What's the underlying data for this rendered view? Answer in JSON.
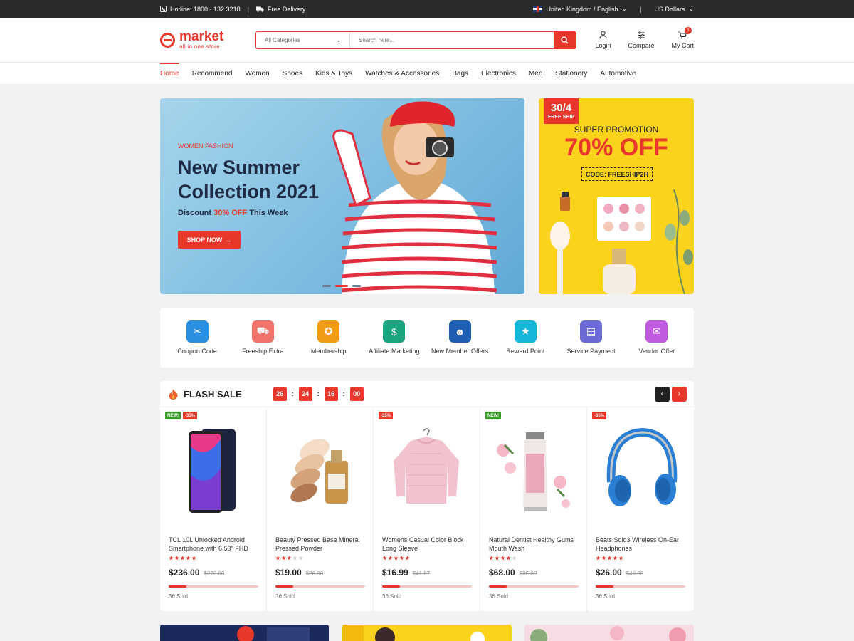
{
  "topbar": {
    "hotline": "Hotline: 1800 - 132 3218",
    "delivery": "Free Delivery",
    "language": "United Kingdom / English",
    "currency": "US Dollars"
  },
  "header": {
    "logo_name": "market",
    "logo_tagline": "all in one store",
    "category_select": "All Categories",
    "search_placeholder": "Search here...",
    "login": "Login",
    "compare": "Compare",
    "cart": "My Cart",
    "cart_count": "1"
  },
  "nav": {
    "items": [
      "Home",
      "Recommend",
      "Women",
      "Shoes",
      "Kids & Toys",
      "Watches & Accessories",
      "Bags",
      "Electronics",
      "Men",
      "Stationery",
      "Automotive"
    ]
  },
  "hero": {
    "kicker": "WOMEN FASHION",
    "title": "New Summer Collection 2021",
    "discount_prefix": "Discount ",
    "discount_value": "30% OFF",
    "discount_suffix": " This Week",
    "cta": "SHOP NOW",
    "slides": 3,
    "active_slide": 2
  },
  "promo": {
    "date": "30/4",
    "free_ship": "FREE SHIP",
    "subtitle": "SUPER PROMOTION",
    "headline": "70% OFF",
    "code": "CODE: FREESHIP2H"
  },
  "features": [
    {
      "label": "Coupon Code",
      "icon": "coupon-icon",
      "color": "#2a8fe0"
    },
    {
      "label": "Freeship Extra",
      "icon": "truck-icon",
      "color": "#f0736a"
    },
    {
      "label": "Membership",
      "icon": "medal-icon",
      "color": "#f29b16"
    },
    {
      "label": "Affiliate Marketing",
      "icon": "money-icon",
      "color": "#1aa47f"
    },
    {
      "label": "New Member Offers",
      "icon": "users-icon",
      "color": "#1f5fb3"
    },
    {
      "label": "Reward Point",
      "icon": "reward-icon",
      "color": "#16b6d8"
    },
    {
      "label": "Service Payment",
      "icon": "payment-icon",
      "color": "#6a6bd6"
    },
    {
      "label": "Vendor Offer",
      "icon": "vendor-icon",
      "color": "#c05be0"
    }
  ],
  "flash_sale": {
    "title": "FLASH SALE",
    "timer": [
      "26",
      "24",
      "16",
      "00"
    ],
    "products": [
      {
        "name": "TCL 10L Unlocked Android Smartphone with 6.53\" FHD",
        "price": "$236.00",
        "old_price": "$276.00",
        "sold": "36 Sold",
        "rating": 5,
        "sold_fraction": 0.2,
        "badges": [
          "NEW!",
          "-35%"
        ]
      },
      {
        "name": "Beauty Pressed Base Mineral Pressed Powder",
        "price": "$19.00",
        "old_price": "$26.00",
        "sold": "36 Sold",
        "rating": 3,
        "sold_fraction": 0.2,
        "badges": []
      },
      {
        "name": "Womens Casual Color Block Long Sleeve",
        "price": "$16.99",
        "old_price": "$41.87",
        "sold": "36 Sold",
        "rating": 5,
        "sold_fraction": 0.2,
        "badges": [
          "-35%"
        ]
      },
      {
        "name": "Natural Dentist Healthy Gums Mouth Wash",
        "price": "$68.00",
        "old_price": "$86.00",
        "sold": "36 Sold",
        "rating": 4,
        "sold_fraction": 0.2,
        "badges": [
          "NEW!"
        ]
      },
      {
        "name": "Beats Solo3 Wireless On-Ear Headphones",
        "price": "$26.00",
        "old_price": "$46.00",
        "sold": "36 Sold",
        "rating": 5,
        "sold_fraction": 0.2,
        "badges": [
          "-35%"
        ]
      }
    ]
  },
  "colors": {
    "accent": "#e8372b",
    "topbar": "#2b2b2b",
    "promo_bg": "#fbd31c"
  }
}
